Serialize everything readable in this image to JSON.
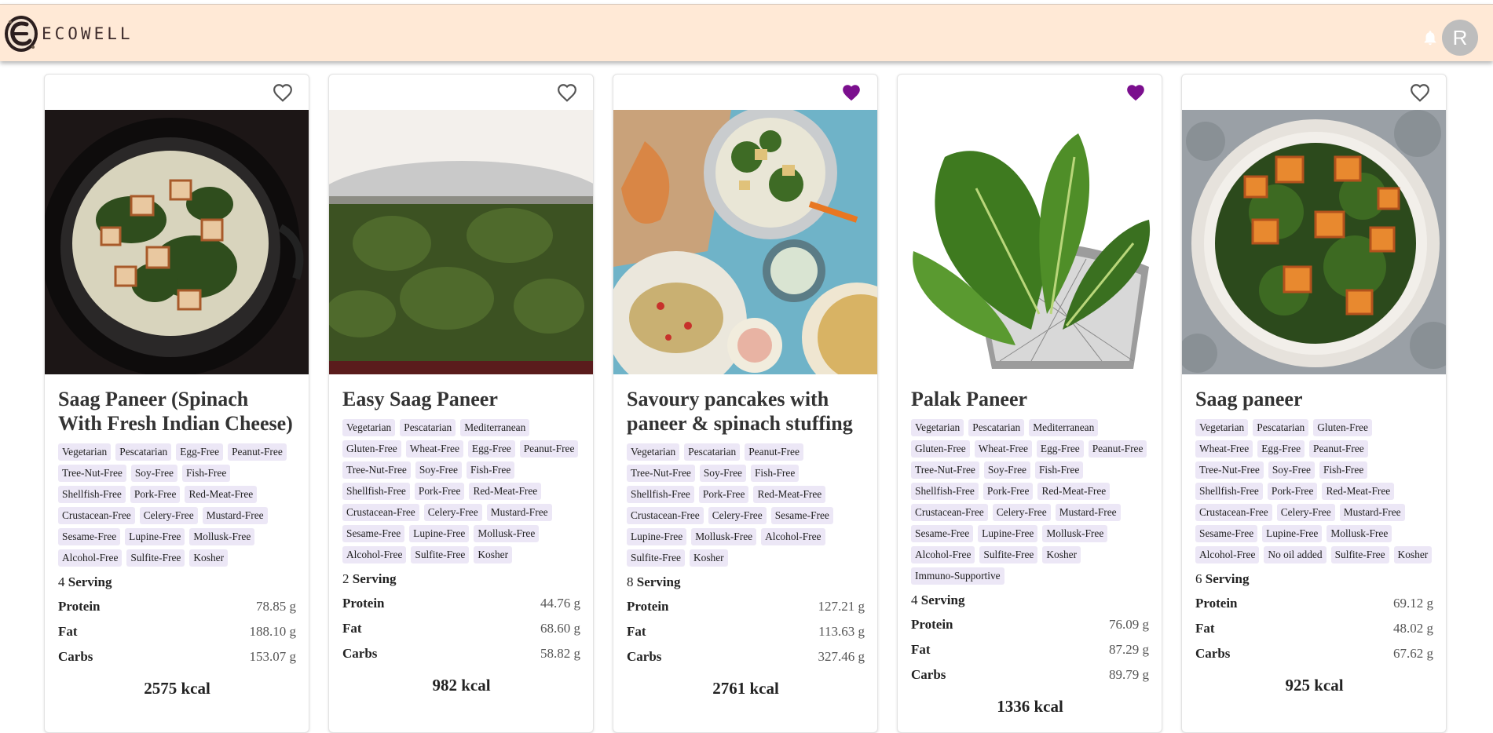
{
  "app": {
    "name": "ECOWELL",
    "avatar_letter": "R"
  },
  "icons": {
    "notifications": "bell-icon",
    "favorite": "heart-icon"
  },
  "colors": {
    "header_bg": "#ffe9d6",
    "tag_bg": "#ece7f6",
    "favorite_active": "#7b0f8e",
    "favorite_inactive": "#555555"
  },
  "serving_label": "Serving",
  "nutrient_labels": {
    "protein": "Protein",
    "fat": "Fat",
    "carbs": "Carbs"
  },
  "recipes": [
    {
      "title": "Saag Paneer (Spinach With Fresh Indian Cheese)",
      "favorited": false,
      "image": "saag-paneer-pan",
      "tags": [
        "Vegetarian",
        "Pescatarian",
        "Egg-Free",
        "Peanut-Free",
        "Tree-Nut-Free",
        "Soy-Free",
        "Fish-Free",
        "Shellfish-Free",
        "Pork-Free",
        "Red-Meat-Free",
        "Crustacean-Free",
        "Celery-Free",
        "Mustard-Free",
        "Sesame-Free",
        "Lupine-Free",
        "Mollusk-Free",
        "Alcohol-Free",
        "Sulfite-Free",
        "Kosher"
      ],
      "servings": "4",
      "protein": "78.85 g",
      "fat": "188.10 g",
      "carbs": "153.07 g",
      "kcal": "2575 kcal"
    },
    {
      "title": "Easy Saag Paneer",
      "favorited": false,
      "image": "saag-paneer-steel-bowl",
      "tags": [
        "Vegetarian",
        "Pescatarian",
        "Mediterranean",
        "Gluten-Free",
        "Wheat-Free",
        "Egg-Free",
        "Peanut-Free",
        "Tree-Nut-Free",
        "Soy-Free",
        "Fish-Free",
        "Shellfish-Free",
        "Pork-Free",
        "Red-Meat-Free",
        "Crustacean-Free",
        "Celery-Free",
        "Mustard-Free",
        "Sesame-Free",
        "Lupine-Free",
        "Mollusk-Free",
        "Alcohol-Free",
        "Sulfite-Free",
        "Kosher"
      ],
      "servings": "2",
      "protein": "44.76 g",
      "fat": "68.60 g",
      "carbs": "58.82 g",
      "kcal": "982 kcal"
    },
    {
      "title": "Savoury pancakes with paneer & spinach stuffing",
      "favorited": true,
      "image": "pancakes-table",
      "tags": [
        "Vegetarian",
        "Pescatarian",
        "Peanut-Free",
        "Tree-Nut-Free",
        "Soy-Free",
        "Fish-Free",
        "Shellfish-Free",
        "Pork-Free",
        "Red-Meat-Free",
        "Crustacean-Free",
        "Celery-Free",
        "Sesame-Free",
        "Lupine-Free",
        "Mollusk-Free",
        "Alcohol-Free",
        "Sulfite-Free",
        "Kosher"
      ],
      "servings": "8",
      "protein": "127.21 g",
      "fat": "113.63 g",
      "carbs": "327.46 g",
      "kcal": "2761 kcal"
    },
    {
      "title": "Palak Paneer",
      "favorited": true,
      "image": "spinach-colander",
      "tags": [
        "Vegetarian",
        "Pescatarian",
        "Mediterranean",
        "Gluten-Free",
        "Wheat-Free",
        "Egg-Free",
        "Peanut-Free",
        "Tree-Nut-Free",
        "Soy-Free",
        "Fish-Free",
        "Shellfish-Free",
        "Pork-Free",
        "Red-Meat-Free",
        "Crustacean-Free",
        "Celery-Free",
        "Mustard-Free",
        "Sesame-Free",
        "Lupine-Free",
        "Mollusk-Free",
        "Alcohol-Free",
        "Sulfite-Free",
        "Kosher",
        "Immuno-Supportive"
      ],
      "servings": "4",
      "protein": "76.09 g",
      "fat": "87.29 g",
      "carbs": "89.79 g",
      "kcal": "1336 kcal"
    },
    {
      "title": "Saag paneer",
      "favorited": false,
      "image": "saag-paneer-white-bowl",
      "tags": [
        "Vegetarian",
        "Pescatarian",
        "Gluten-Free",
        "Wheat-Free",
        "Egg-Free",
        "Peanut-Free",
        "Tree-Nut-Free",
        "Soy-Free",
        "Fish-Free",
        "Shellfish-Free",
        "Pork-Free",
        "Red-Meat-Free",
        "Crustacean-Free",
        "Celery-Free",
        "Mustard-Free",
        "Sesame-Free",
        "Lupine-Free",
        "Mollusk-Free",
        "Alcohol-Free",
        "No oil added",
        "Sulfite-Free",
        "Kosher"
      ],
      "servings": "6",
      "protein": "69.12 g",
      "fat": "48.02 g",
      "carbs": "67.62 g",
      "kcal": "925 kcal"
    }
  ]
}
